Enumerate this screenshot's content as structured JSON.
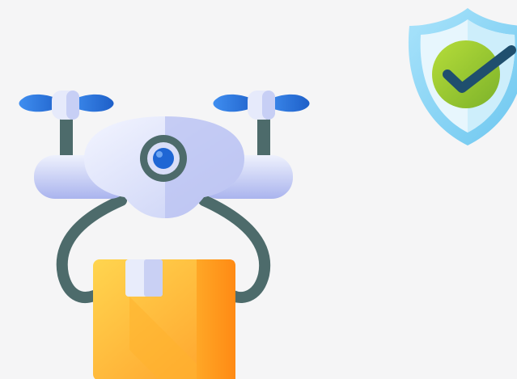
{
  "scene": {
    "background_color": "#f5f5f6",
    "illustrations": [
      {
        "icon": "drone-icon"
      },
      {
        "icon": "delivery-box-icon"
      },
      {
        "icon": "shield-check-icon"
      }
    ]
  },
  "colors": {
    "drone_body_light": "#eef1fd",
    "drone_body_shade": "#aeb8ef",
    "drone_arm": "#4d6b6b",
    "propeller_blue": "#2b6fd6",
    "propeller_hub": "#e6eafb",
    "camera_lens": "#1f66d4",
    "box_light": "#ffd54f",
    "box_dark": "#ff8f1a",
    "box_tape": "#e8ecfb",
    "shield_outer": "#8fd6f5",
    "shield_inner": "#e7f6fd",
    "check_circle": "#9ccc2e",
    "check_mark": "#1f4f6e"
  }
}
